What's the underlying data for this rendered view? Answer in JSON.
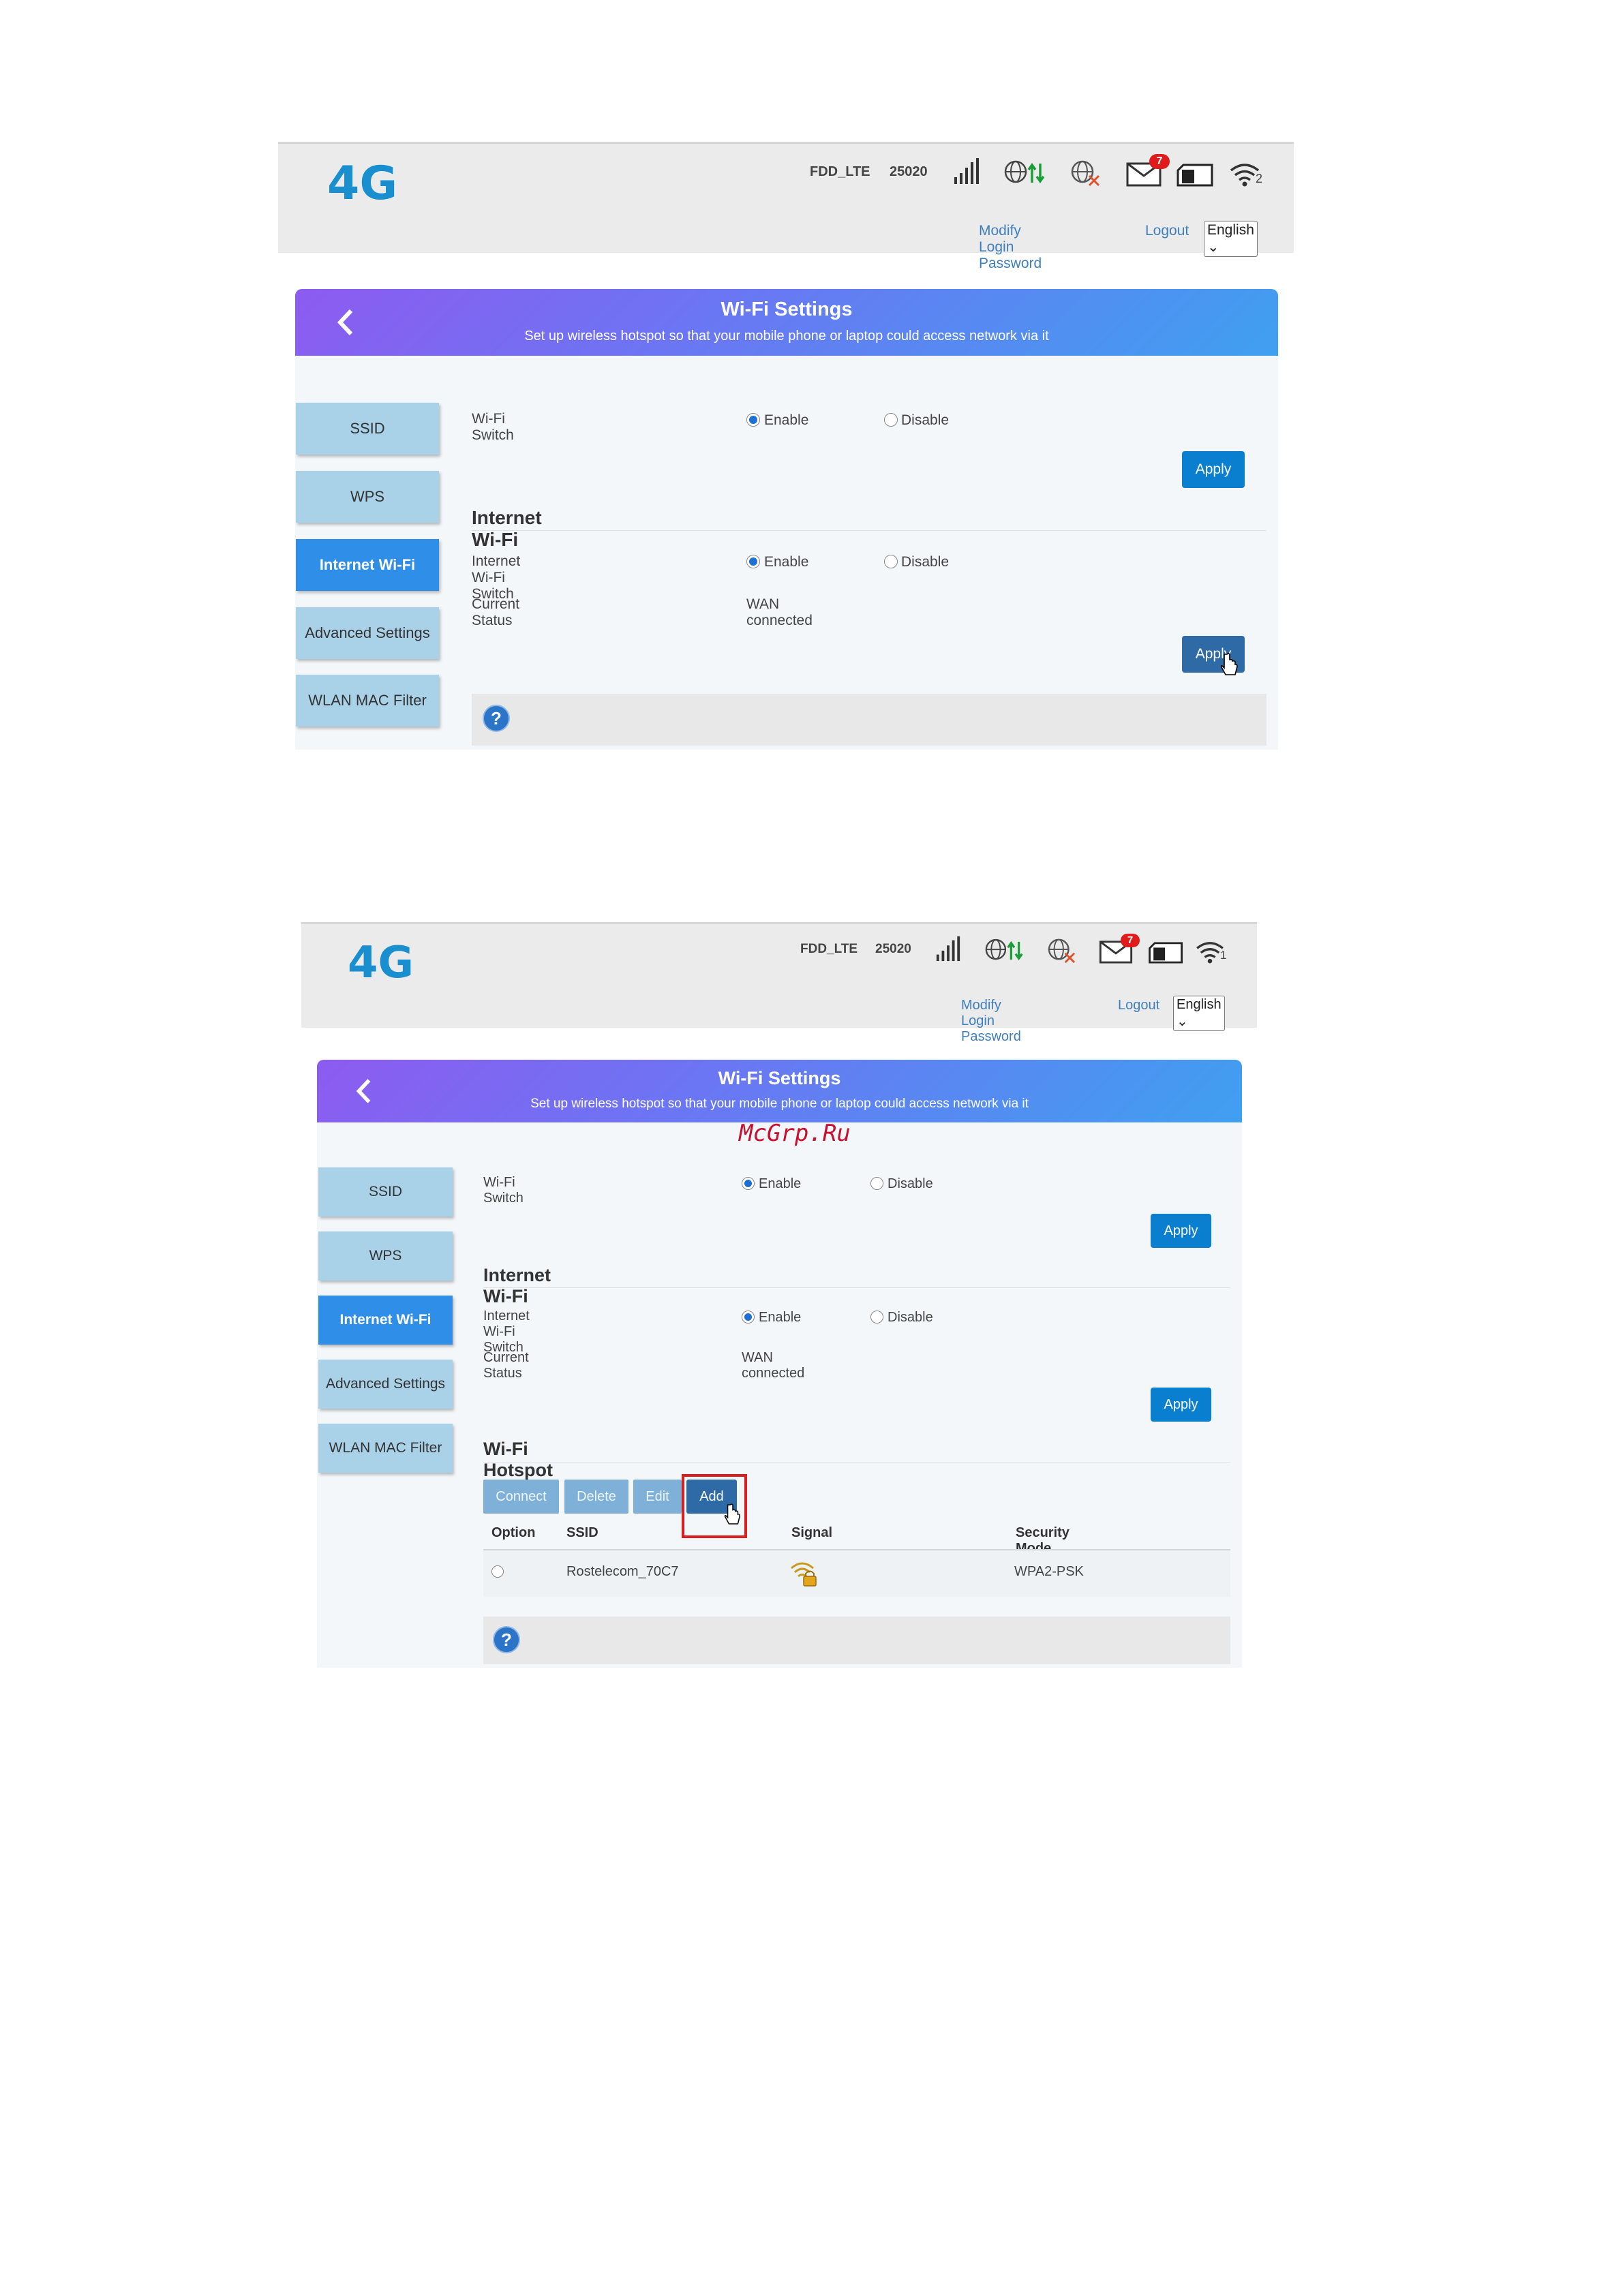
{
  "shot1": {
    "header": {
      "logo": "4G",
      "network_type": "FDD_LTE",
      "operator_code": "25020",
      "sms_count": "7",
      "wifi_clients": "2",
      "modify_password": "Modify Login Password",
      "logout": "Logout",
      "language": "English"
    },
    "banner": {
      "title": "Wi-Fi Settings",
      "subtitle": "Set up wireless hotspot so that your mobile phone or laptop could access network via it"
    },
    "nav": [
      "SSID",
      "WPS",
      "Internet Wi-Fi",
      "Advanced Settings",
      "WLAN MAC Filter"
    ],
    "wifi_switch_label": "Wi-Fi Switch",
    "enable": "Enable",
    "disable": "Disable",
    "apply": "Apply",
    "section_title": "Internet Wi-Fi",
    "internet_switch_label": "Internet Wi-Fi Switch",
    "status_label": "Current Status",
    "status_value": "WAN connected",
    "help": "?"
  },
  "shot2": {
    "header": {
      "logo": "4G",
      "network_type": "FDD_LTE",
      "operator_code": "25020",
      "sms_count": "7",
      "wifi_clients": "1",
      "modify_password": "Modify Login Password",
      "logout": "Logout",
      "language": "English"
    },
    "banner": {
      "title": "Wi-Fi Settings",
      "subtitle": "Set up wireless hotspot so that your mobile phone or laptop could access network via it"
    },
    "watermark": "McGrp.Ru",
    "nav": [
      "SSID",
      "WPS",
      "Internet Wi-Fi",
      "Advanced Settings",
      "WLAN MAC Filter"
    ],
    "wifi_switch_label": "Wi-Fi Switch",
    "enable": "Enable",
    "disable": "Disable",
    "apply": "Apply",
    "section_title": "Internet Wi-Fi",
    "internet_switch_label": "Internet Wi-Fi Switch",
    "status_label": "Current Status",
    "status_value": "WAN connected",
    "hotspot_title": "Wi-Fi Hotspot",
    "toolbar": {
      "connect": "Connect",
      "delete": "Delete",
      "edit": "Edit",
      "add": "Add"
    },
    "table": {
      "headers": [
        "Option",
        "SSID",
        "Signal",
        "Security Mode"
      ],
      "rows": [
        {
          "ssid": "Rostelecom_70C7",
          "security": "WPA2-PSK"
        }
      ]
    },
    "help": "?"
  },
  "colors": {
    "accent": "#0a7fd0",
    "nav_active": "#2f8ee8",
    "nav": "#a9d1e8",
    "logo": "#1a8fcf",
    "highlight": "#d81e1e"
  }
}
